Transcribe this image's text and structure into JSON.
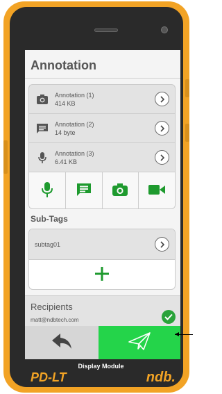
{
  "screen": {
    "title": "Annotation",
    "annotations": [
      {
        "name": "Annotation (1)",
        "size": "414 KB",
        "icon": "camera-icon"
      },
      {
        "name": "Annotation (2)",
        "size": "14 byte",
        "icon": "message-icon"
      },
      {
        "name": "Annotation (3)",
        "size": "6.41 KB",
        "icon": "microphone-icon"
      }
    ],
    "toolbar": [
      "microphone-icon",
      "message-icon",
      "camera-icon",
      "video-icon"
    ],
    "subtags_label": "Sub-Tags",
    "subtags": [
      {
        "name": "subtag01"
      }
    ],
    "recipients": {
      "label": "Recipients",
      "email": "matt@ndbtech.com"
    }
  },
  "device": {
    "module_label": "Display Module",
    "brand_left": "PD-LT",
    "brand_right": "ndb."
  },
  "colors": {
    "frame": "#f2a325",
    "accent_green": "#2aa33a",
    "send_green": "#24d44a",
    "toolbar_green": "#1e9a2e"
  }
}
